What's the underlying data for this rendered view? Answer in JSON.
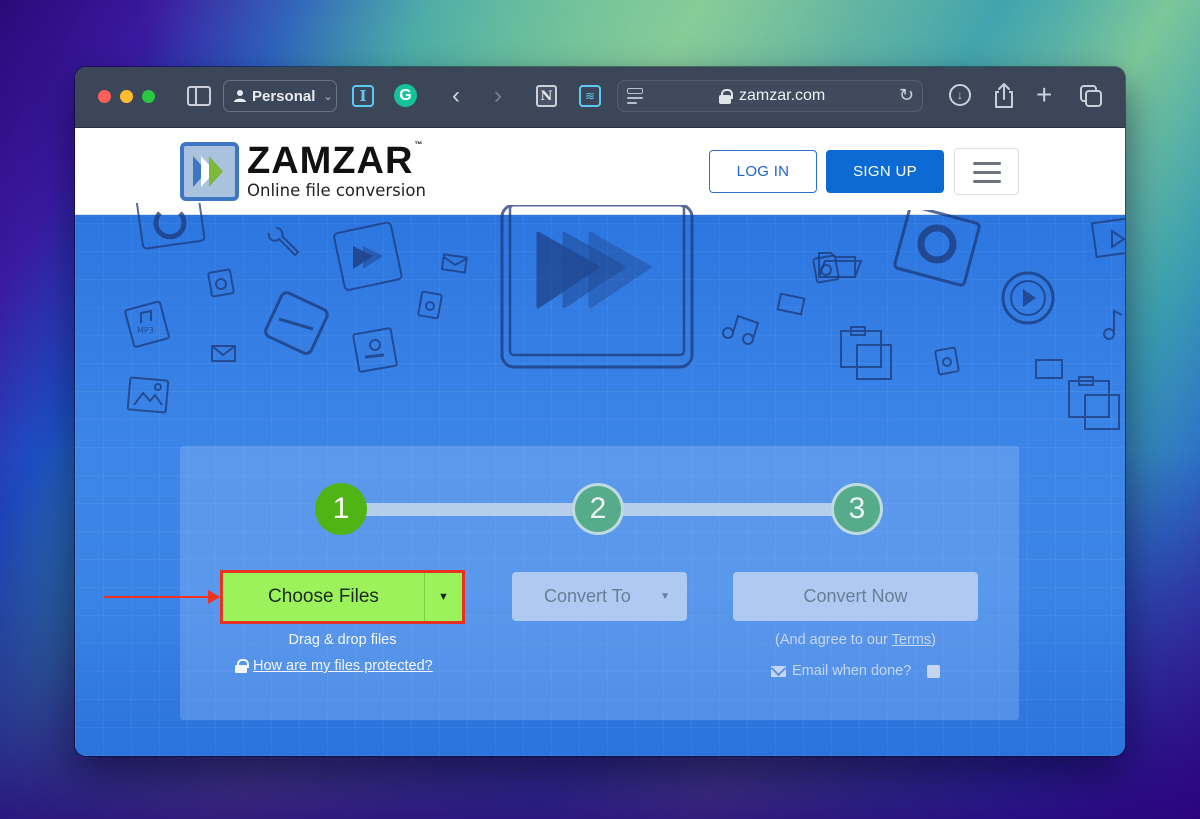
{
  "browser": {
    "profile_label": "Personal",
    "address": "zamzar.com",
    "extensions": [
      {
        "name": "instapaper-extension",
        "glyph": "I"
      },
      {
        "name": "grammarly-extension",
        "glyph": "G"
      },
      {
        "name": "notion-extension",
        "glyph": "N"
      },
      {
        "name": "stack-extension",
        "glyph": "≋"
      }
    ],
    "icons": {
      "back": "‹",
      "forward": "›",
      "reload": "↻",
      "download": "↓",
      "plus": "+",
      "chevron": "⌄"
    }
  },
  "site": {
    "logo": {
      "wordmark": "ZAMZAR",
      "trademark": "™",
      "tagline": "Online file conversion",
      "colors": {
        "frame": "#3d76c2",
        "arrow_blue": "#3d76c2",
        "arrow_white": "#ffffff",
        "arrow_green": "#7cb83a"
      }
    },
    "nav": {
      "login_label": "LOG IN",
      "signup_label": "SIGN UP"
    },
    "converter": {
      "steps": [
        {
          "number": "1",
          "state": "active"
        },
        {
          "number": "2",
          "state": "pending"
        },
        {
          "number": "3",
          "state": "pending"
        }
      ],
      "choose_files_label": "Choose Files",
      "drag_drop_text": "Drag & drop files",
      "protected_link": "How are my files protected?",
      "convert_to_label": "Convert To",
      "convert_now_label": "Convert Now",
      "agree_prefix": "(And agree to our ",
      "agree_terms": "Terms",
      "agree_suffix": ")",
      "email_label": "Email when done?",
      "email_checked": false
    }
  },
  "colors": {
    "accent_green": "#4fb414",
    "choose_button": "#9bf25a",
    "annotation_red": "#e53222",
    "signup_blue": "#0b6ad4",
    "hero_blue": "#2c76e0"
  }
}
